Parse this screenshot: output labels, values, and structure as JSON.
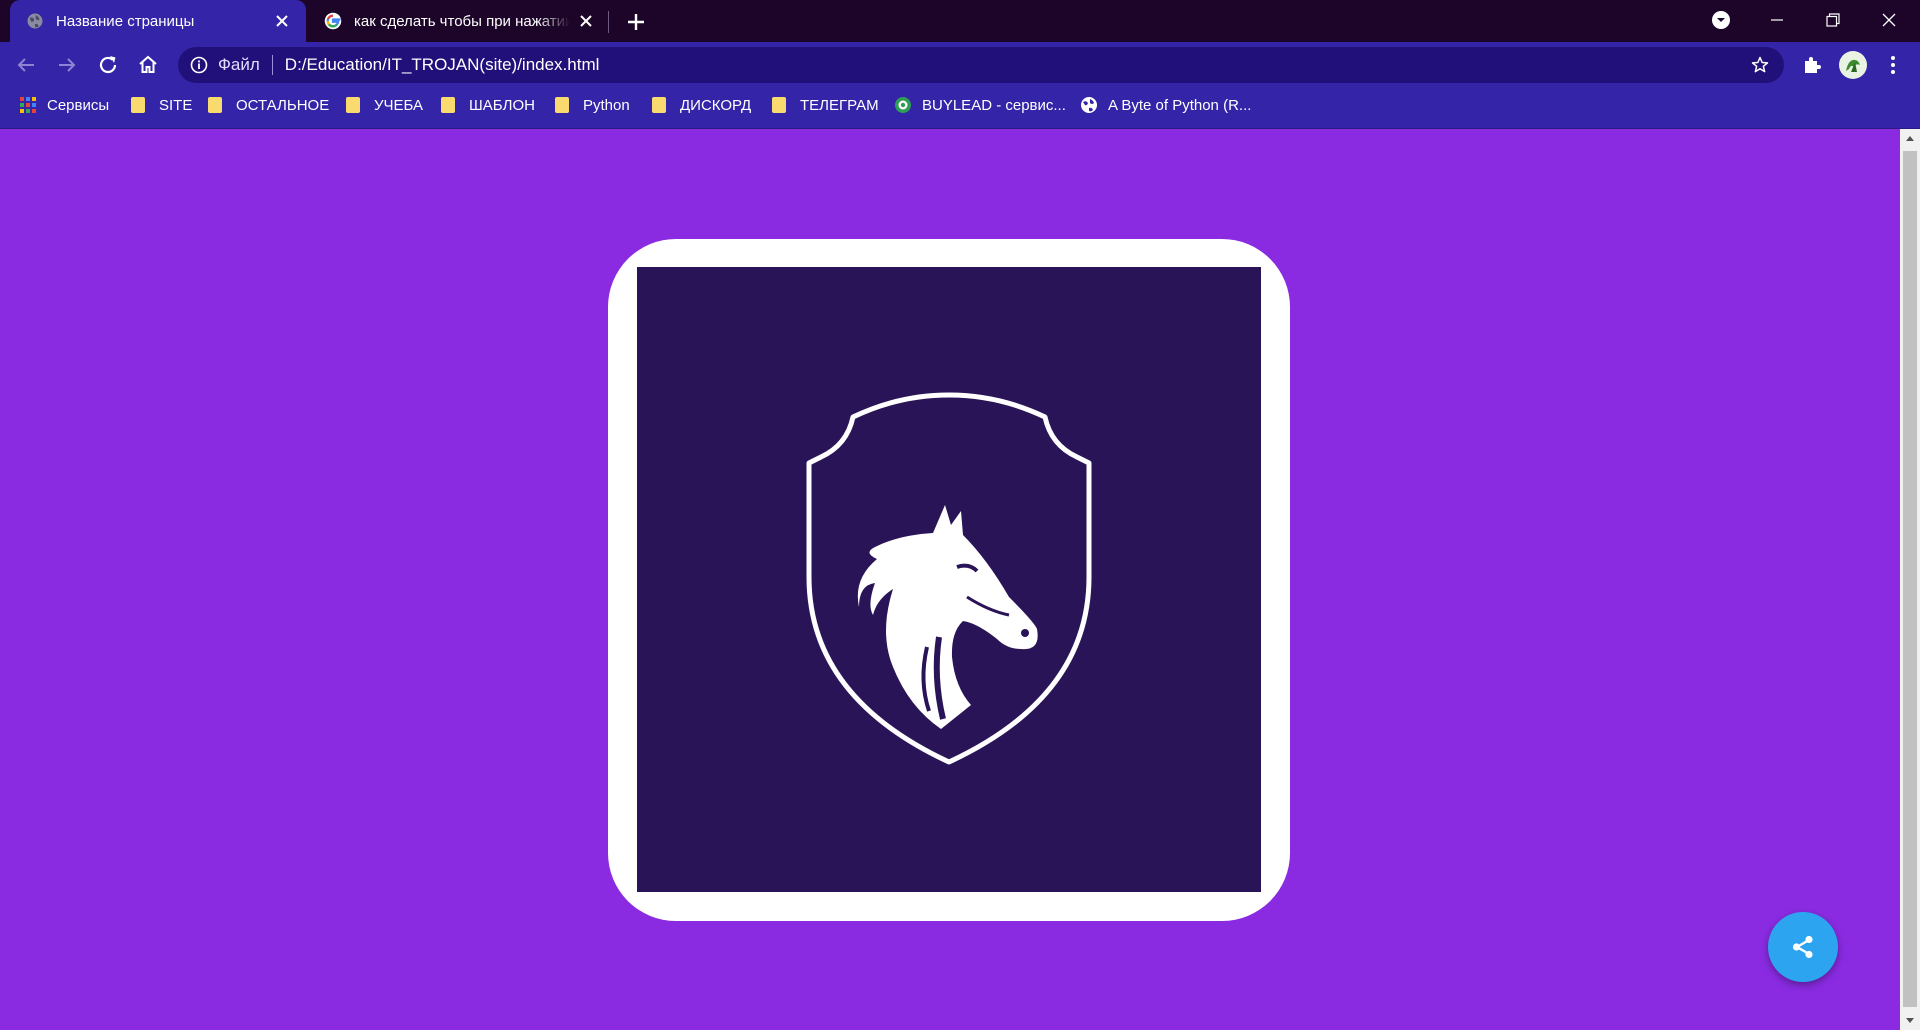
{
  "tabs": [
    {
      "title": "Название страницы",
      "favicon": "globe-icon",
      "active": true
    },
    {
      "title": "как сделать чтобы при нажатии",
      "favicon": "google-icon",
      "active": false
    }
  ],
  "address_bar": {
    "scheme_label": "Файл",
    "url": "D:/Education/IT_TROJAN(site)/index.html"
  },
  "bookmarks": [
    {
      "label": "Сервисы",
      "icon": "apps-grid-icon"
    },
    {
      "label": "SITE",
      "icon": "folder-icon"
    },
    {
      "label": "ОСТАЛЬНОЕ",
      "icon": "folder-icon"
    },
    {
      "label": "УЧЕБА",
      "icon": "folder-icon"
    },
    {
      "label": "ШАБЛОН",
      "icon": "folder-icon"
    },
    {
      "label": "Python",
      "icon": "folder-icon"
    },
    {
      "label": "ДИСКОРД",
      "icon": "folder-icon"
    },
    {
      "label": "ТЕЛЕГРАМ",
      "icon": "folder-icon"
    },
    {
      "label": "BUYLEAD - сервис...",
      "icon": "buylead-icon"
    },
    {
      "label": "A Byte of Python (R...",
      "icon": "globe-icon"
    }
  ],
  "colors": {
    "page_background": "#8A2BE2",
    "browser_frame": "#3424A8",
    "title_bar": "#1C0528",
    "logo_background": "#2A1458",
    "share_button": "#2CA4F0"
  },
  "page": {
    "logo_icon": "horse-shield-logo-icon",
    "share_icon": "share-icon"
  }
}
